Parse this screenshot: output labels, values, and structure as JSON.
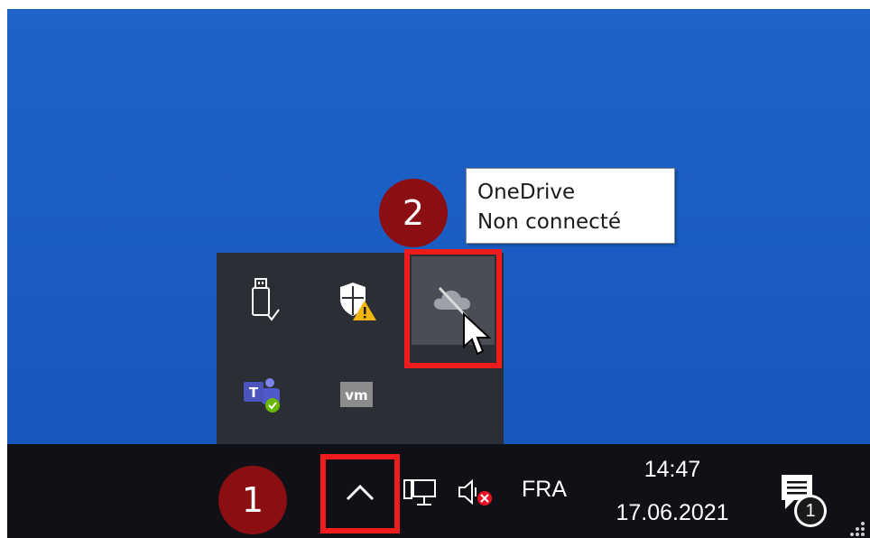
{
  "tooltip": {
    "line1": "OneDrive",
    "line2": "Non connecté"
  },
  "steps": {
    "first": "1",
    "second": "2"
  },
  "tray": {
    "language": "FRA",
    "time": "14:47",
    "date": "17.06.2021",
    "notification_count": "1"
  },
  "flyout_icons": [
    "usb-eject-icon",
    "security-warning-icon",
    "onedrive-disconnected-icon",
    "teams-icon",
    "vmware-icon"
  ],
  "colors": {
    "highlight": "#ee1c1c",
    "badge": "#8b0f12",
    "desktop": "#1a5cc2",
    "taskbar": "#0f1116"
  }
}
